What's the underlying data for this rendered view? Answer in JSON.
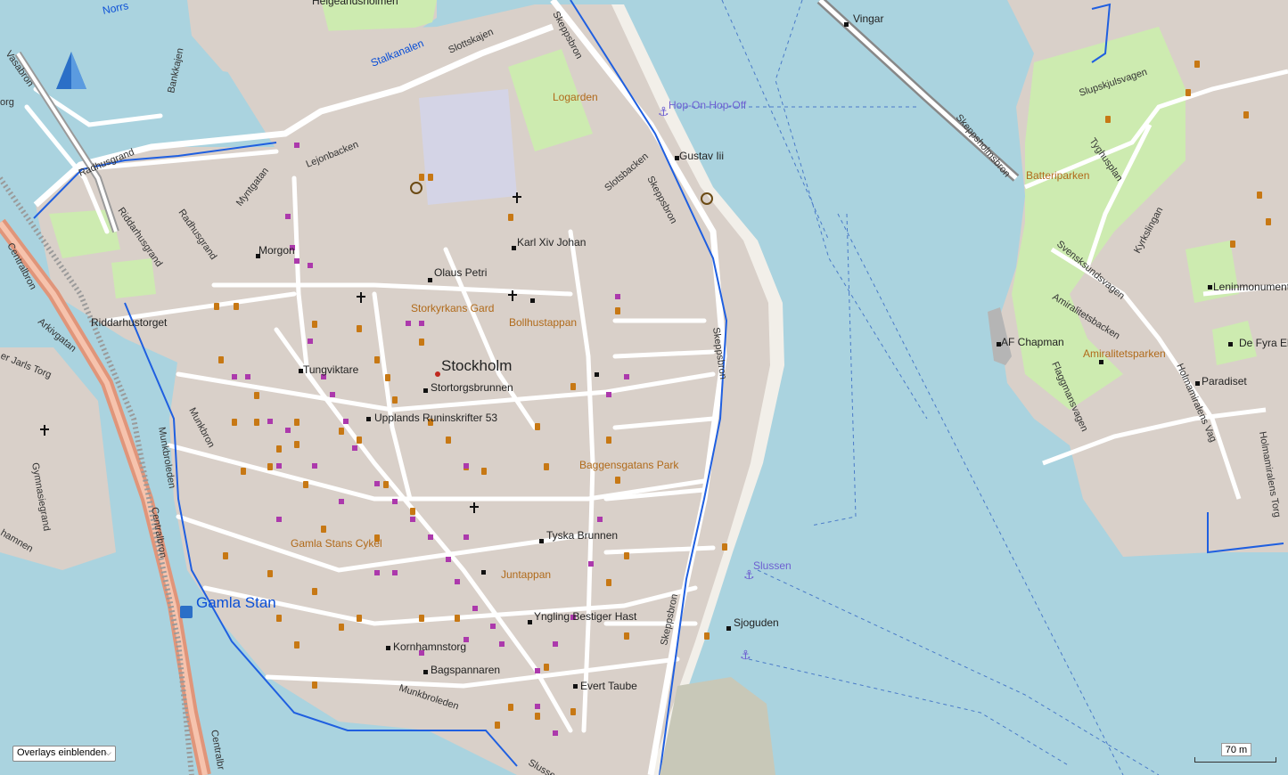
{
  "overlay_control": {
    "label": "Overlays einblenden"
  },
  "scale": {
    "label": "70 m"
  },
  "labels": {
    "gamla_stan": "Gamla Stan",
    "stockholm": "Stockholm",
    "slussen": "Slussen",
    "hop_on": "Hop-On Hop-Off",
    "vingar": "Vingar",
    "gustav": "Gustav Iii",
    "karl": "Karl Xiv Johan",
    "olaus": "Olaus Petri",
    "morgon": "Morgon",
    "storkyrkans": "Storkyrkans Gard",
    "bollhus": "Bollhustappan",
    "tungviktare": "Tungviktare",
    "stortorg": "Stortorgsbrunnen",
    "upplands": "Upplands Runinskrifter 53",
    "baggens": "Baggensgatans Park",
    "tyska": "Tyska Brunnen",
    "juntappan": "Juntappan",
    "ynglingr": "Yngling Bestiger Hast",
    "kornhamn": "Kornhamnstorg",
    "bagspann": "Bagspannaren",
    "evert": "Evert Taube",
    "sjoguden": "Sjoguden",
    "gamla_cykel": "Gamla Stans Cykel",
    "logarden": "Logarden",
    "riddarhus": "Riddarhustorget",
    "af_chapman": "AF Chapman",
    "amiralitet": "Amiralitetsparken",
    "paradiset": "Paradiset",
    "batteri": "Batteriparken",
    "lenin": "Leninmonument",
    "fyra": "De Fyra Eleme",
    "helgeand": "Helgeandsholmen",
    "stalkanalen": "Stalkanalen",
    "norrs": "Norrs"
  },
  "streets": {
    "slottskajen": "Slottskajen",
    "bankkajen": "Bankkajen",
    "lejonbacken": "Lejonbacken",
    "myntgatan": "Myntgatan",
    "radhusgrand1": "Radhusgrand",
    "radhusgrand2": "Radhusgrand",
    "riddarhusgrand": "Riddarhusgrand",
    "vasabron": "Vasabron",
    "centralbron1": "Centralbron",
    "centralbron2": "Centralbron",
    "centralbron3": "Centralbr",
    "arkivgatan": "Arkivgatan",
    "jarlstorg": "er Jarls Torg",
    "munkbron": "Munkbron",
    "munkbroleden1": "Munkbroleden",
    "munkbroleden2": "Munkbroleden",
    "gymnasie": "Gymnasiegrand",
    "hammen": "hamnen",
    "skeppsbron1": "Skeppsbron",
    "skeppsbron2": "Skeppsbron",
    "skeppsbron3": "Skeppsbron",
    "skeppsbron4": "Skeppsbron",
    "slotsbacken": "Slotsbacken",
    "slussen_st": "Slussen",
    "skeppsholmsbron": "Skeppsholmsbron",
    "slupskjul": "Slupskjulsvagen",
    "tyghus": "Tyghusplan",
    "kyrkslingan": "Kyrkslingan",
    "svensksund": "Svensksundsvagen",
    "amiralitetsbacken": "Amiralitetsbacken",
    "flaggmans": "Flaggmansvagen",
    "holmamiralens1": "Holmamiralens Vag",
    "holmamiralens2": "Holmamiralens Torg",
    "org": "org"
  },
  "colors": {
    "water": "#aad3df",
    "land": "#f2efe9",
    "building": "#d9d0c9",
    "park": "#cdebb0",
    "poi_food": "#c77814",
    "poi_shop": "#ac39ac",
    "route": "#1f5fe0"
  }
}
